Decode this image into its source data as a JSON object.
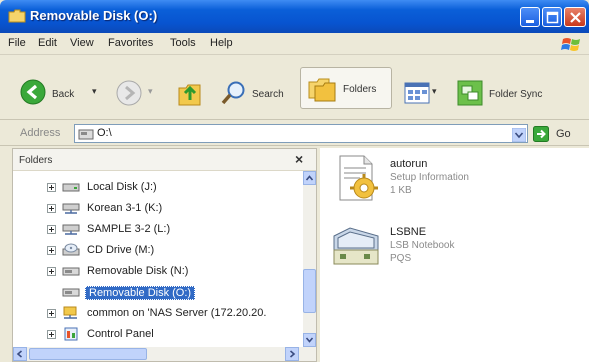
{
  "window": {
    "title": "Removable Disk (O:)"
  },
  "menu": [
    "File",
    "Edit",
    "View",
    "Favorites",
    "Tools",
    "Help"
  ],
  "toolbar": {
    "back_label": "Back",
    "search_label": "Search",
    "folders_label": "Folders",
    "folder_sync_label": "Folder Sync"
  },
  "address": {
    "label": "Address",
    "value": "O:\\",
    "go_label": "Go"
  },
  "folders_pane": {
    "title": "Folders",
    "close_glyph": "×",
    "items": [
      {
        "label": "Local Disk (J:)",
        "icon": "drive-icon"
      },
      {
        "label": "Korean 3-1 (K:)",
        "icon": "network-drive-icon"
      },
      {
        "label": "SAMPLE 3-2 (L:)",
        "icon": "network-drive-icon"
      },
      {
        "label": "CD Drive (M:)",
        "icon": "cd-drive-icon"
      },
      {
        "label": "Removable Disk (N:)",
        "icon": "removable-disk-icon"
      },
      {
        "label": "Removable Disk (O:)",
        "icon": "removable-disk-icon",
        "selected": true
      },
      {
        "label": "common on 'NAS Server (172.20.20.",
        "icon": "network-share-icon"
      },
      {
        "label": "Control Panel",
        "icon": "control-panel-icon"
      }
    ]
  },
  "files": [
    {
      "name": "autorun",
      "type": "Setup Information",
      "size": "1 KB",
      "icon": "setup-info-icon"
    },
    {
      "name": "LSBNE",
      "type": "LSB Notebook",
      "size": "PQS",
      "icon": "notebook-icon"
    }
  ],
  "colors": {
    "title_blue": "#0854d0",
    "selection": "#316ac5",
    "window_bg": "#ece9d8"
  }
}
